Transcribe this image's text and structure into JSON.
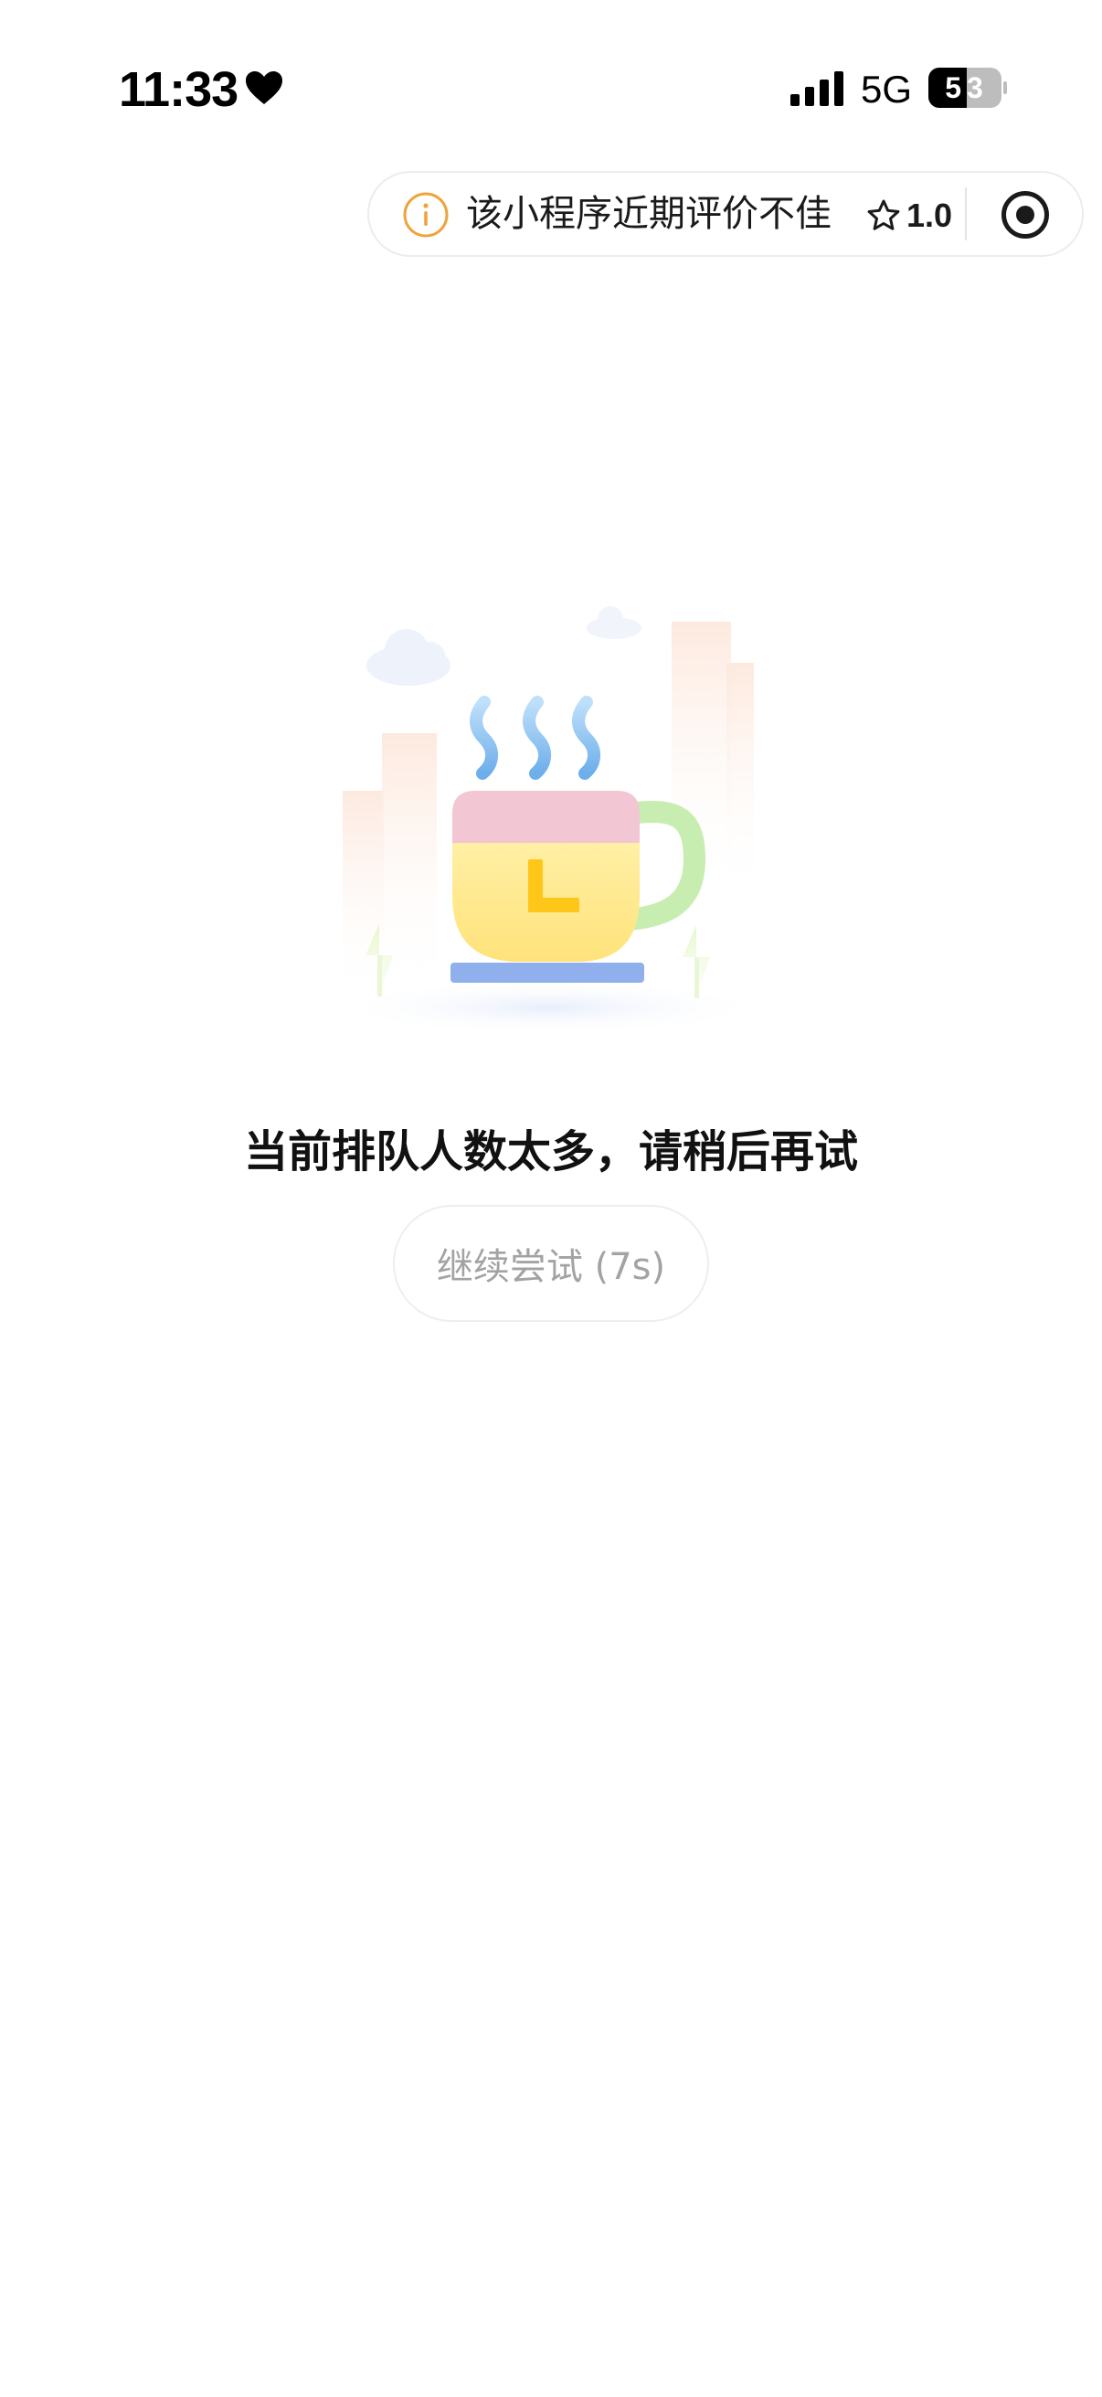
{
  "status_bar": {
    "time": "11:33",
    "heart_icon": "heart-icon",
    "signal_icon": "cellular-signal-icon",
    "network": "5G",
    "battery": "53"
  },
  "capsule": {
    "warning_icon": "info-circle-icon",
    "warning_text": "该小程序近期评价不佳",
    "rating_icon": "star-outline-icon",
    "rating": "1.0",
    "menu_icon": "record-target-icon"
  },
  "main": {
    "illustration": "coffee-cup-waiting-illustration",
    "message": "当前排队人数太多，请稍后再试",
    "retry_button": "继续尝试 (7s)"
  },
  "colors": {
    "warning_orange": "#F0A33C",
    "cup_yellow": "#FFEE9A",
    "cup_pink": "#F2C4D2",
    "handle_green": "#C9EDB2",
    "steam_blue": "#7DB7EE",
    "saucer_blue": "#8FB2EE",
    "button_text_gray": "#A3A3A3"
  }
}
